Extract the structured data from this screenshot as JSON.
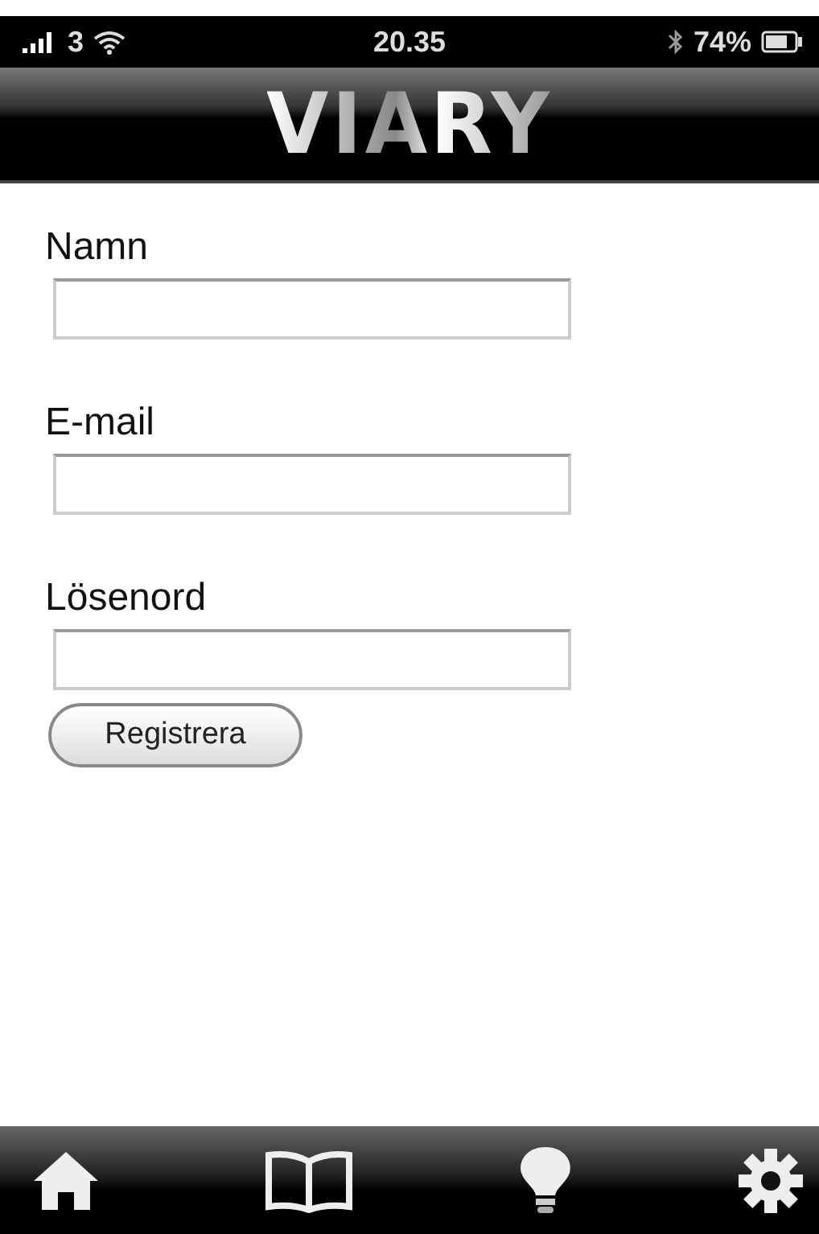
{
  "status_bar": {
    "carrier": "3",
    "time": "20.35",
    "battery": "74%"
  },
  "header": {
    "logo": "VIARY"
  },
  "fields": [
    {
      "label": "Namn"
    },
    {
      "label": "E-mail"
    },
    {
      "label": "Lösenord"
    }
  ],
  "submit_button": "Registrera",
  "tab_bar": [
    {
      "kind": "home"
    },
    {
      "kind": "book"
    },
    {
      "kind": "bulb"
    },
    {
      "kind": "gear"
    }
  ]
}
